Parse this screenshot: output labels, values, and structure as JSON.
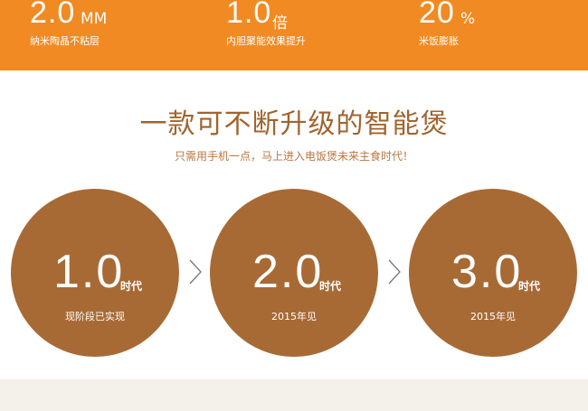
{
  "stats": [
    {
      "value": "2.0",
      "unit": "MM",
      "desc": "纳米陶晶不粘层"
    },
    {
      "value": "1.0",
      "unit": "倍",
      "desc": "内胆聚能效果提升"
    },
    {
      "value": "20",
      "unit": "%",
      "desc": "米饭膨胀"
    }
  ],
  "headline": {
    "title": "一款可不断升级的智能煲",
    "subtitle": "只需用手机一点，马上进入电饭煲未来主食时代！"
  },
  "versions": [
    {
      "number": "1.0",
      "era": "时代",
      "note": "现阶段已实现"
    },
    {
      "number": "2.0",
      "era": "时代",
      "note": "2015年见"
    },
    {
      "number": "3.0",
      "era": "时代",
      "note": "2015年见"
    }
  ],
  "colors": {
    "band": "#f18a23",
    "circle": "#a86a35",
    "title": "#a0642e",
    "footer": "#f4f0ea"
  },
  "icons": [
    "chevron-right-icon",
    "chevron-right-icon"
  ]
}
